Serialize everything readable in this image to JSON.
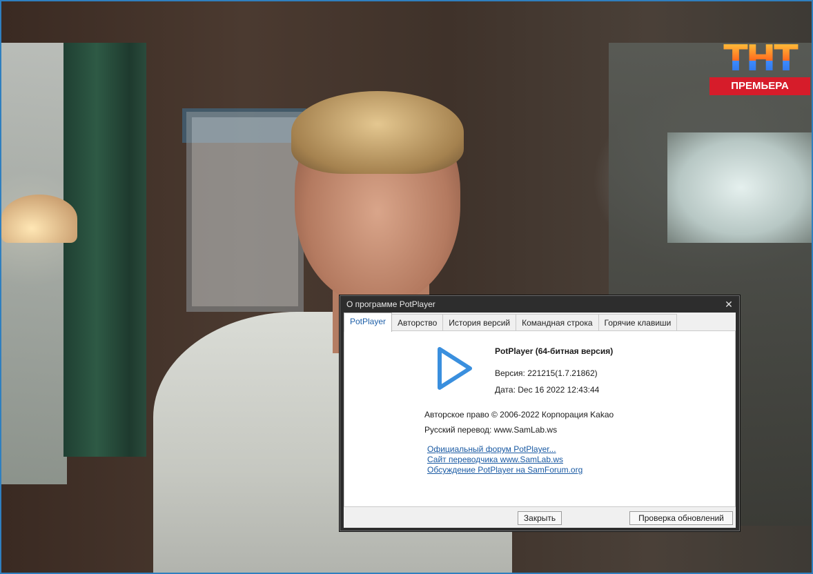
{
  "logo": {
    "word": "ТНТ",
    "tag": "ПРЕМЬЕРА"
  },
  "dialog": {
    "title": "О программе PotPlayer",
    "close_glyph": "✕",
    "tabs": [
      {
        "label": "PotPlayer",
        "active": true
      },
      {
        "label": "Авторство",
        "active": false
      },
      {
        "label": "История версий",
        "active": false
      },
      {
        "label": "Командная строка",
        "active": false
      },
      {
        "label": "Горячие клавиши",
        "active": false
      }
    ],
    "product": "PotPlayer (64-битная версия)",
    "version": "Версия: 221215(1.7.21862)",
    "date": "Дата: Dec 16 2022 12:43:44",
    "copyright": "Авторское право © 2006-2022 Корпорация Kakao",
    "translation": "Русский перевод: www.SamLab.ws",
    "links": [
      "Официальный форум PotPlayer...",
      "Сайт переводчика www.SamLab.ws",
      "Обсуждение PotPlayer на SamForum.org"
    ],
    "close_button": "Закрыть",
    "update_button": "Проверка обновлений",
    "play_icon": "play-icon",
    "accent": "#3a8fde"
  }
}
